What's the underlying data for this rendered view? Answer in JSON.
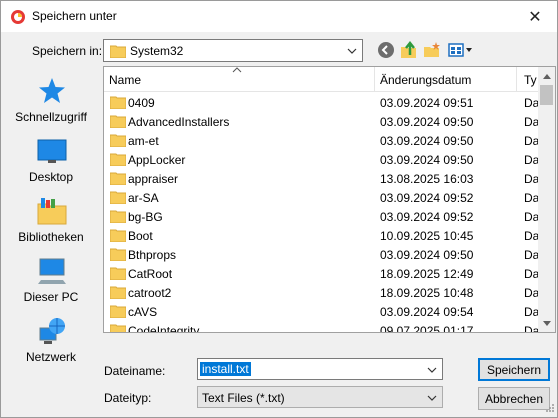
{
  "window": {
    "title": "Speichern unter",
    "close_glyph": "✕"
  },
  "toolbar": {
    "save_in_label": "Speichern in:",
    "location": "System32",
    "icons": [
      "back-icon",
      "up-folder-icon",
      "new-folder-icon",
      "view-menu-icon"
    ]
  },
  "places": [
    {
      "label": "Schnellzugriff",
      "icon": "star-icon"
    },
    {
      "label": "Desktop",
      "icon": "desktop-icon"
    },
    {
      "label": "Bibliotheken",
      "icon": "libraries-icon"
    },
    {
      "label": "Dieser PC",
      "icon": "computer-icon"
    },
    {
      "label": "Netzwerk",
      "icon": "network-icon"
    }
  ],
  "list": {
    "columns": {
      "name": "Name",
      "date": "Änderungsdatum",
      "type": "Ty"
    },
    "rows": [
      {
        "name": "0409",
        "date": "03.09.2024 09:51",
        "type": "Da"
      },
      {
        "name": "AdvancedInstallers",
        "date": "03.09.2024 09:50",
        "type": "Da"
      },
      {
        "name": "am-et",
        "date": "03.09.2024 09:50",
        "type": "Da"
      },
      {
        "name": "AppLocker",
        "date": "03.09.2024 09:50",
        "type": "Da"
      },
      {
        "name": "appraiser",
        "date": "13.08.2025 16:03",
        "type": "Da"
      },
      {
        "name": "ar-SA",
        "date": "03.09.2024 09:52",
        "type": "Da"
      },
      {
        "name": "bg-BG",
        "date": "03.09.2024 09:52",
        "type": "Da"
      },
      {
        "name": "Boot",
        "date": "10.09.2025 10:45",
        "type": "Da"
      },
      {
        "name": "Bthprops",
        "date": "03.09.2024 09:50",
        "type": "Da"
      },
      {
        "name": "CatRoot",
        "date": "18.09.2025 12:49",
        "type": "Da"
      },
      {
        "name": "catroot2",
        "date": "18.09.2025 10:48",
        "type": "Da"
      },
      {
        "name": "cAVS",
        "date": "03.09.2024 09:54",
        "type": "Da"
      },
      {
        "name": "CodeIntegrity",
        "date": "09.07.2025 01:17",
        "type": "Da"
      }
    ]
  },
  "bottom": {
    "filename_label": "Dateiname:",
    "filename_value": "install.txt",
    "filetype_label": "Dateityp:",
    "filetype_value": "Text Files (*.txt)",
    "save_button": "Speichern",
    "cancel_button": "Abbrechen"
  },
  "colors": {
    "folder": "#f7cc5a",
    "selection": "#0078d7",
    "accent_icon": "#1e88e5"
  }
}
